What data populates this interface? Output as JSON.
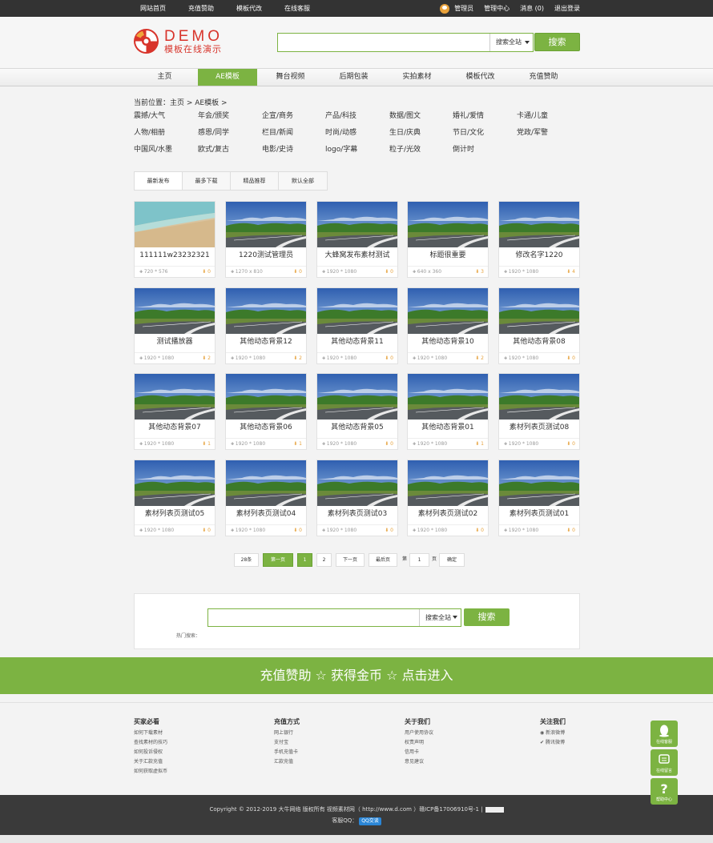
{
  "topbar": {
    "left_links": [
      "网站首页",
      "充值赞助",
      "模板代改",
      "在线客服"
    ],
    "right_links": [
      "管理员",
      "管理中心",
      "消息 (0)",
      "退出登录"
    ]
  },
  "logo": {
    "text": "DEMO",
    "subtitle": "模板在线演示"
  },
  "search": {
    "placeholder": "",
    "scope": "搜索全站",
    "button": "搜索"
  },
  "nav": {
    "items": [
      "主页",
      "AE模板",
      "舞台视频",
      "后期包装",
      "实拍素材",
      "模板代改",
      "充值赞助"
    ],
    "active": "AE模板"
  },
  "breadcrumb": "当前位置：主页 > AE模板 >",
  "categories": [
    [
      "震撼/大气",
      "年会/颁奖",
      "企宣/商务",
      "产品/科技",
      "数据/图文",
      "婚礼/爱情",
      "卡通/儿童"
    ],
    [
      "人物/相册",
      "感恩/同学",
      "栏目/新闻",
      "时尚/动感",
      "生日/庆典",
      "节日/文化",
      "党政/军警"
    ],
    [
      "中国风/水墨",
      "欧式/复古",
      "电影/史诗",
      "logo/字幕",
      "粒子/光效",
      "倒计时"
    ]
  ],
  "sort_tabs": [
    "最新发布",
    "最多下载",
    "精品推荐",
    "默认全部"
  ],
  "cards": [
    {
      "title": "111111w23232321",
      "dim": "720 * 576",
      "dl": "0",
      "thumb": "beach"
    },
    {
      "title": "1220测试管理员",
      "dim": "1270 x 810",
      "dl": "0",
      "thumb": "road"
    },
    {
      "title": "大蜂窝发布素材测试",
      "dim": "1920 * 1080",
      "dl": "0",
      "thumb": "road"
    },
    {
      "title": "标题很重要",
      "dim": "640 x 360",
      "dl": "3",
      "thumb": "road"
    },
    {
      "title": "修改名字1220",
      "dim": "1920 * 1080",
      "dl": "4",
      "thumb": "road"
    },
    {
      "title": "测试播放器",
      "dim": "1920 * 1080",
      "dl": "2",
      "thumb": "road"
    },
    {
      "title": "其他动态背景12",
      "dim": "1920 * 1080",
      "dl": "2",
      "thumb": "road"
    },
    {
      "title": "其他动态背景11",
      "dim": "1920 * 1080",
      "dl": "0",
      "thumb": "road"
    },
    {
      "title": "其他动态背景10",
      "dim": "1920 * 1080",
      "dl": "2",
      "thumb": "road"
    },
    {
      "title": "其他动态背景08",
      "dim": "1920 * 1080",
      "dl": "0",
      "thumb": "road"
    },
    {
      "title": "其他动态背景07",
      "dim": "1920 * 1080",
      "dl": "1",
      "thumb": "road"
    },
    {
      "title": "其他动态背景06",
      "dim": "1920 * 1080",
      "dl": "1",
      "thumb": "road"
    },
    {
      "title": "其他动态背景05",
      "dim": "1920 * 1080",
      "dl": "0",
      "thumb": "road"
    },
    {
      "title": "其他动态背景01",
      "dim": "1920 * 1080",
      "dl": "1",
      "thumb": "road"
    },
    {
      "title": "素材列表页测试08",
      "dim": "1920 * 1080",
      "dl": "0",
      "thumb": "road"
    },
    {
      "title": "素材列表页测试05",
      "dim": "1920 * 1080",
      "dl": "0",
      "thumb": "road"
    },
    {
      "title": "素材列表页测试04",
      "dim": "1920 * 1080",
      "dl": "0",
      "thumb": "road"
    },
    {
      "title": "素材列表页测试03",
      "dim": "1920 * 1080",
      "dl": "0",
      "thumb": "road"
    },
    {
      "title": "素材列表页测试02",
      "dim": "1920 * 1080",
      "dl": "0",
      "thumb": "road"
    },
    {
      "title": "素材列表页测试01",
      "dim": "1920 * 1080",
      "dl": "0",
      "thumb": "road"
    }
  ],
  "pager": {
    "total": "28条",
    "first": "第一页",
    "pages": [
      "1",
      "2"
    ],
    "current": "1",
    "next": "下一页",
    "last": "最后页",
    "goto_prefix": "第",
    "goto_value": "1",
    "goto_suffix": "页",
    "confirm": "确定"
  },
  "bottom_search": {
    "scope": "搜索全站",
    "button": "搜索",
    "hot_label": "热门搜索："
  },
  "banner": "充值赞助 ☆ 获得金币 ☆ 点击进入",
  "footer": {
    "cols": [
      {
        "heading": "买家必看",
        "items": [
          "如何下载素材",
          "查找素材的技巧",
          "如何投诉侵权",
          "关于汇款充值",
          "如何获取虚拟币"
        ]
      },
      {
        "heading": "充值方式",
        "items": [
          "网上银行",
          "支付宝",
          "手机充值卡",
          "汇款充值"
        ]
      },
      {
        "heading": "关于我们",
        "items": [
          "用户使用协议",
          "权责声明",
          "信用卡",
          "意见建议"
        ]
      },
      {
        "heading": "关注我们",
        "items": [
          "新浪微博",
          "腾讯微博"
        ]
      }
    ]
  },
  "copyright": {
    "line1": "Copyright © 2012-2019 大牛网络 版权所有 视频素材网（ http://www.d.com ）赣ICP备17006910号-1 |",
    "line2_label": "客服QQ：",
    "qq_badge": "QQ交谈"
  },
  "floatbar": [
    "在线客服",
    "在线留言",
    "帮助中心"
  ],
  "colors": {
    "accent": "#7cb342",
    "topbar": "#333333",
    "logo": "#d8342b",
    "download": "#e6a23c"
  }
}
